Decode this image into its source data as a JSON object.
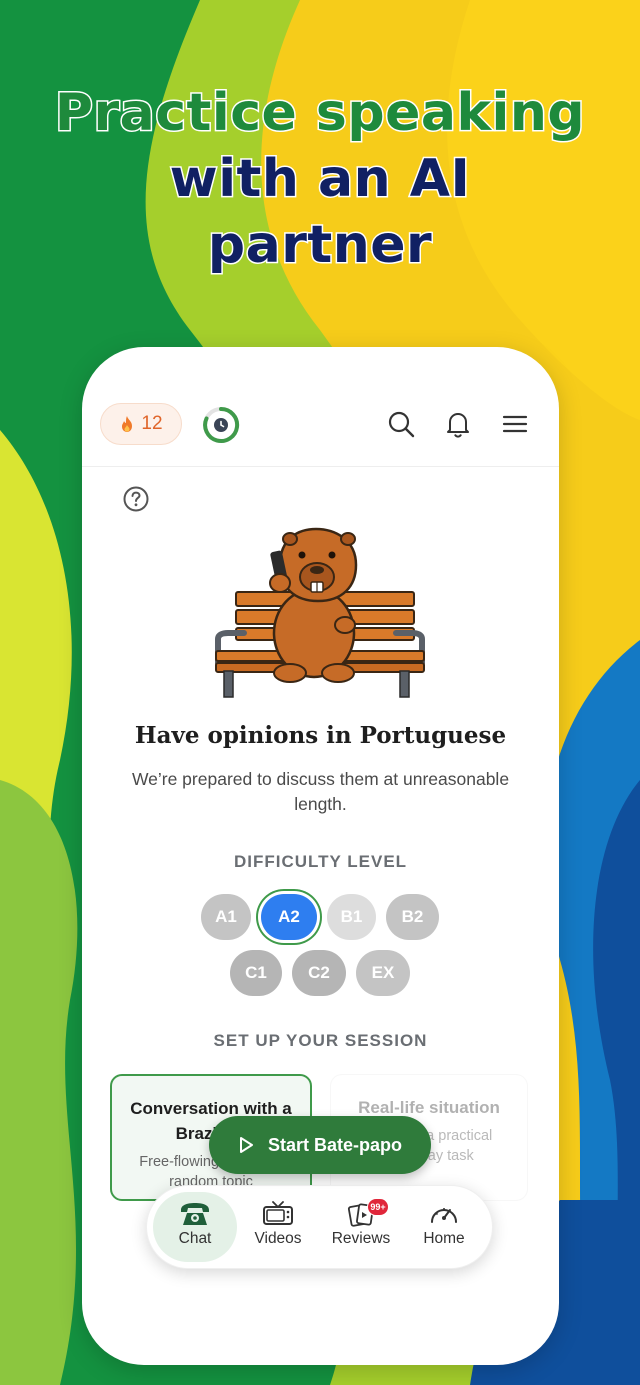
{
  "headline": {
    "line1": "Practice speaking",
    "line2": "with an AI",
    "line3": "partner"
  },
  "topbar": {
    "streak_count": "12"
  },
  "lesson": {
    "title": "Have opinions in Portuguese",
    "subtitle": "We’re prepared to discuss them at unreasonable length."
  },
  "difficulty": {
    "label": "DIFFICULTY LEVEL",
    "levels": [
      "A1",
      "A2",
      "B1",
      "B2",
      "C1",
      "C2",
      "EX"
    ],
    "selected": "A2"
  },
  "session": {
    "label": "SET UP YOUR SESSION",
    "cards": [
      {
        "title": "Conversation with a Brazilian",
        "desc": "Free-flowing chat on a random topic"
      },
      {
        "title": "Real-life situation",
        "desc": "Roleplay a practical everyday task"
      }
    ]
  },
  "start_button": {
    "label": "Start Bate-papo"
  },
  "nav": {
    "items": [
      {
        "label": "Chat"
      },
      {
        "label": "Videos"
      },
      {
        "label": "Reviews"
      },
      {
        "label": "Home"
      }
    ],
    "reviews_badge": "99+"
  },
  "colors": {
    "accent_green": "#2f7b3b",
    "selected_blue": "#2e7ef0",
    "streak_orange": "#e0652a",
    "headline_green": "#1e8a3c",
    "headline_navy": "#102063"
  }
}
